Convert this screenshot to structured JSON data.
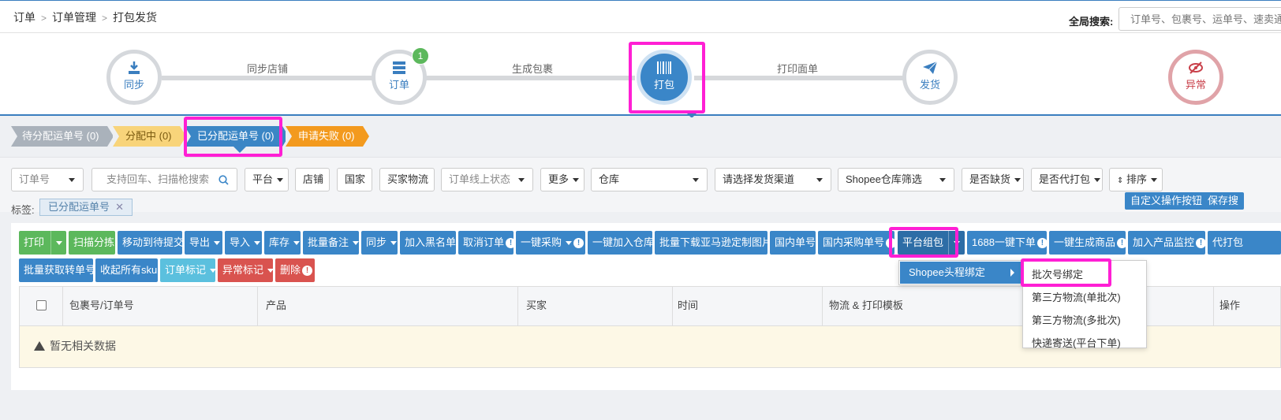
{
  "breadcrumb": [
    "订单",
    "订单管理",
    "打包发货"
  ],
  "global_search": {
    "label": "全局搜索:",
    "placeholder": "订单号、包裹号、运单号、速卖通"
  },
  "steps": [
    {
      "label": "同步",
      "icon": "download-icon"
    },
    {
      "label": "订单",
      "icon": "server-icon",
      "badge": "1"
    },
    {
      "label": "打包",
      "icon": "barcode-icon",
      "active": true
    },
    {
      "label": "发货",
      "icon": "paper-plane-icon"
    },
    {
      "label": "异常",
      "icon": "eye-slash-icon"
    }
  ],
  "step_links": [
    "同步店铺",
    "生成包裹",
    "打印面单"
  ],
  "status_tabs": [
    "待分配运单号 (0)",
    "分配中 (0)",
    "已分配运单号 (0)",
    "申请失败 (0)"
  ],
  "filters": {
    "order_no": "订单号",
    "search_placeholder": "支持回车、扫描枪搜索",
    "platform": "平台",
    "shop": "店铺",
    "country": "国家",
    "buyer_logistics": "买家物流",
    "online_status": "订单线上状态",
    "more": "更多",
    "warehouse": "仓库",
    "channel": "请选择发货渠道",
    "shopee_wh": "Shopee仓库筛选",
    "stockout": "是否缺货",
    "proxy_pack": "是否代打包",
    "sort": "排序"
  },
  "tags": {
    "label": "标签:",
    "value": "已分配运单号"
  },
  "right_buttons": [
    "自定义操作按钮",
    "保存搜"
  ],
  "toolbar_row1": [
    {
      "label": "打印",
      "style": "green"
    },
    {
      "label": "扫描分拣",
      "style": "green"
    },
    {
      "label": "移动到待提交",
      "style": "blue"
    },
    {
      "label": "导出",
      "style": "blue"
    },
    {
      "label": "导入",
      "style": "blue"
    },
    {
      "label": "库存",
      "style": "blue"
    },
    {
      "label": "批量备注",
      "style": "blue"
    },
    {
      "label": "同步",
      "style": "blue"
    },
    {
      "label": "加入黑名单",
      "style": "blue"
    },
    {
      "label": "取消订单",
      "style": "blue"
    },
    {
      "label": "一键采购",
      "style": "blue"
    },
    {
      "label": "一键加入仓库",
      "style": "blue"
    },
    {
      "label": "批量下载亚马逊定制图片",
      "style": "blue"
    },
    {
      "label": "国内单号",
      "style": "blue"
    },
    {
      "label": "国内采购单号",
      "style": "blue"
    },
    {
      "label": "平台组包",
      "style": "blue"
    },
    {
      "label": "1688一键下单",
      "style": "blue"
    },
    {
      "label": "一键生成商品",
      "style": "blue"
    },
    {
      "label": "加入产品监控",
      "style": "blue"
    },
    {
      "label": "代打包",
      "style": "blue"
    }
  ],
  "toolbar_row2": [
    {
      "label": "批量获取转单号",
      "style": "blue"
    },
    {
      "label": "收起所有sku",
      "style": "blue"
    },
    {
      "label": "订单标记",
      "style": "cyan"
    },
    {
      "label": "异常标记",
      "style": "red"
    },
    {
      "label": "删除",
      "style": "red"
    }
  ],
  "table": {
    "headers": [
      "包裹号/订单号",
      "产品",
      "买家",
      "时间",
      "物流 & 打印模板",
      "操作"
    ],
    "empty_text": "暂无相关数据"
  },
  "submenu_parent": "Shopee头程绑定",
  "submenu_items": [
    "批次号绑定",
    "第三方物流(单批次)",
    "第三方物流(多批次)",
    "快递寄送(平台下单)"
  ],
  "colors": {
    "primary": "#3a86c8",
    "green": "#5cb85c",
    "red": "#d9534f",
    "highlight": "#ff1fd4"
  }
}
